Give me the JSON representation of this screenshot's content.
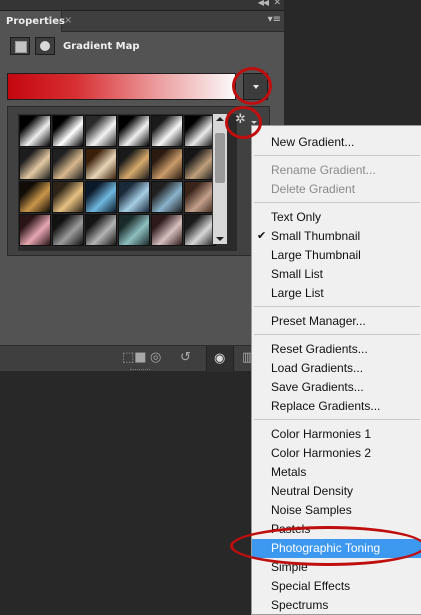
{
  "panel": {
    "tab_label": "Properties",
    "adjustment_title": "Gradient Map"
  },
  "gradient": {
    "start_color": "#c4060f",
    "end_color": "#fbfafa"
  },
  "menu": {
    "items": [
      {
        "label": "New Gradient...",
        "disabled": false
      },
      {
        "label": "Rename Gradient...",
        "disabled": true
      },
      {
        "label": "Delete Gradient",
        "disabled": true
      },
      {
        "label": "Text Only",
        "disabled": false
      },
      {
        "label": "Small Thumbnail",
        "disabled": false,
        "checked": true
      },
      {
        "label": "Large Thumbnail",
        "disabled": false
      },
      {
        "label": "Small List",
        "disabled": false
      },
      {
        "label": "Large List",
        "disabled": false
      },
      {
        "label": "Preset Manager...",
        "disabled": false
      },
      {
        "label": "Reset Gradients...",
        "disabled": false
      },
      {
        "label": "Load Gradients...",
        "disabled": false
      },
      {
        "label": "Save Gradients...",
        "disabled": false
      },
      {
        "label": "Replace Gradients...",
        "disabled": false
      },
      {
        "label": "Color Harmonies 1",
        "disabled": false
      },
      {
        "label": "Color Harmonies 2",
        "disabled": false
      },
      {
        "label": "Metals",
        "disabled": false
      },
      {
        "label": "Neutral Density",
        "disabled": false
      },
      {
        "label": "Noise Samples",
        "disabled": false
      },
      {
        "label": "Pastels",
        "disabled": false
      },
      {
        "label": "Photographic Toning",
        "disabled": false,
        "highlighted": true
      },
      {
        "label": "Simple",
        "disabled": false
      },
      {
        "label": "Special Effects",
        "disabled": false
      },
      {
        "label": "Spectrums",
        "disabled": false
      }
    ]
  },
  "icons": [
    "panel-collapse-icon",
    "panel-close-icon",
    "panel-menu-icon",
    "adjustment-layer-icon",
    "mask-icon",
    "gear-icon",
    "clip-to-layer-icon",
    "view-previous-icon",
    "reset-icon",
    "visibility-eye-icon",
    "trash-icon"
  ],
  "accent_colors": {
    "highlight": "#3d98f0",
    "annotation": "#c00d0d"
  }
}
